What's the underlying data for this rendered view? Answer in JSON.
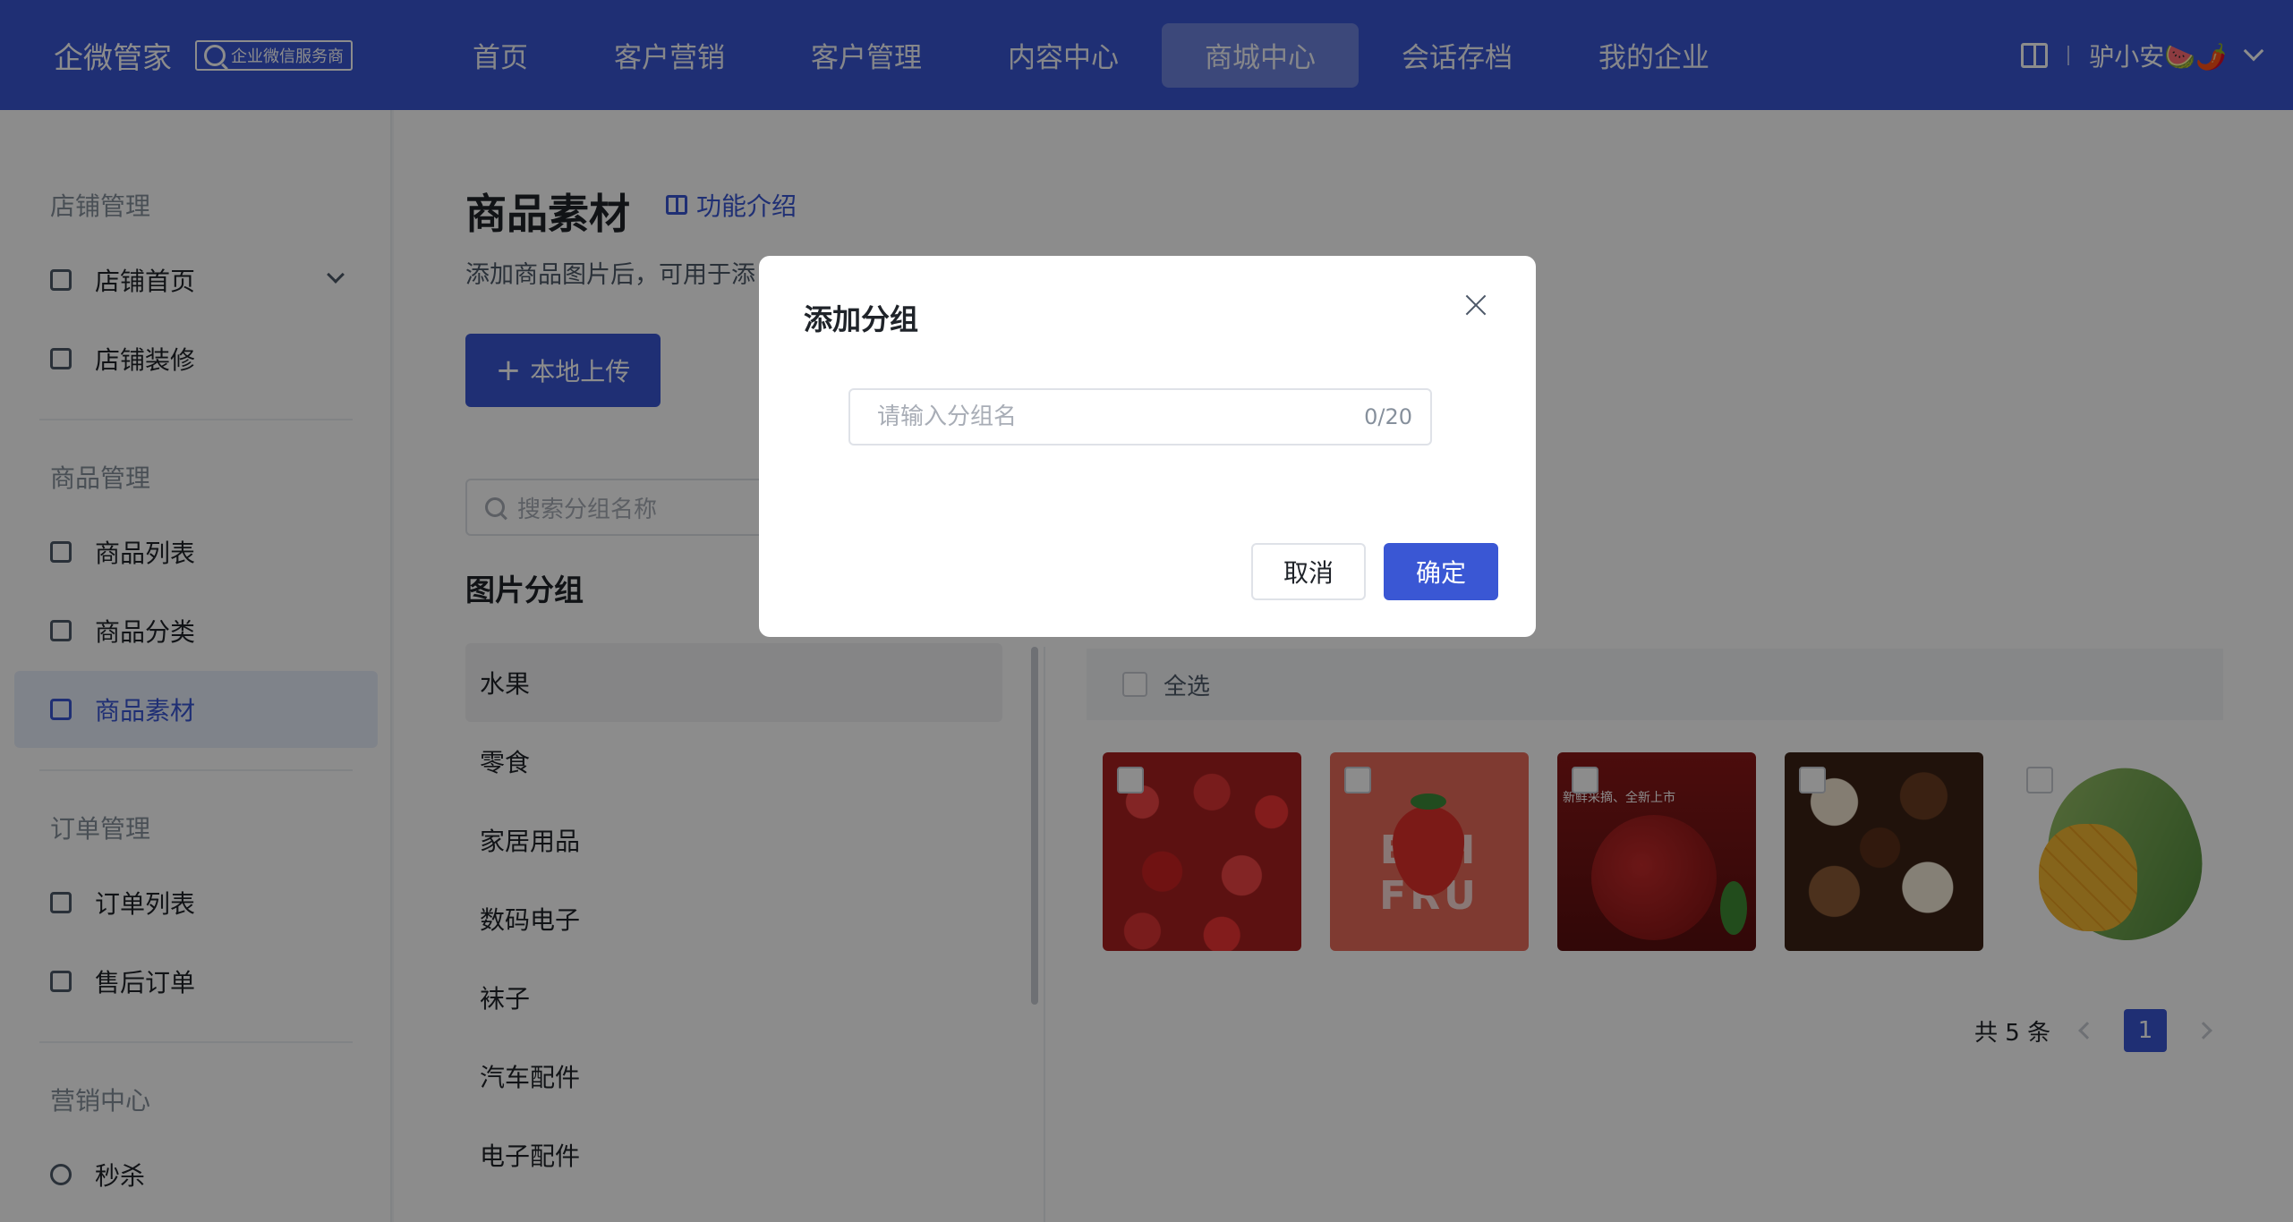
{
  "brand": {
    "name": "企微管家",
    "badge": "企业微信服务商"
  },
  "nav": {
    "items": [
      "首页",
      "客户营销",
      "客户管理",
      "内容中心",
      "商城中心",
      "会话存档",
      "我的企业"
    ],
    "active": "商城中心"
  },
  "user": {
    "name": "驴小安🍉🌶️"
  },
  "sidebar": {
    "sections": [
      "店铺管理",
      "商品管理",
      "订单管理",
      "营销中心"
    ],
    "items": [
      {
        "label": "店铺首页",
        "icon": "store-icon"
      },
      {
        "label": "店铺装修",
        "icon": "decorate-icon"
      },
      {
        "label": "商品列表",
        "icon": "list-icon"
      },
      {
        "label": "商品分类",
        "icon": "category-icon"
      },
      {
        "label": "商品素材",
        "icon": "material-icon",
        "active": true
      },
      {
        "label": "订单列表",
        "icon": "order-icon"
      },
      {
        "label": "售后订单",
        "icon": "after-sale-icon"
      },
      {
        "label": "秒杀",
        "icon": "flash-sale-icon"
      }
    ]
  },
  "page": {
    "title": "商品素材",
    "feature_link": "功能介绍",
    "desc": "添加商品图片后，可用于添",
    "upload_button": "本地上传",
    "search_placeholder": "搜索分组名称",
    "group_title": "图片分组",
    "groups": [
      "水果",
      "零食",
      "家居用品",
      "数码电子",
      "袜子",
      "汽车配件",
      "电子配件"
    ],
    "active_group": "水果",
    "select_all": "全选",
    "total_text": "共 5 条",
    "current_page": "1"
  },
  "modal": {
    "title": "添加分组",
    "input_placeholder": "请输入分组名",
    "input_value": "",
    "counter": "0/20",
    "cancel": "取消",
    "confirm": "确定"
  },
  "colors": {
    "primary": "#3a57d4",
    "overlay": "rgba(0,0,0,0.45)"
  }
}
